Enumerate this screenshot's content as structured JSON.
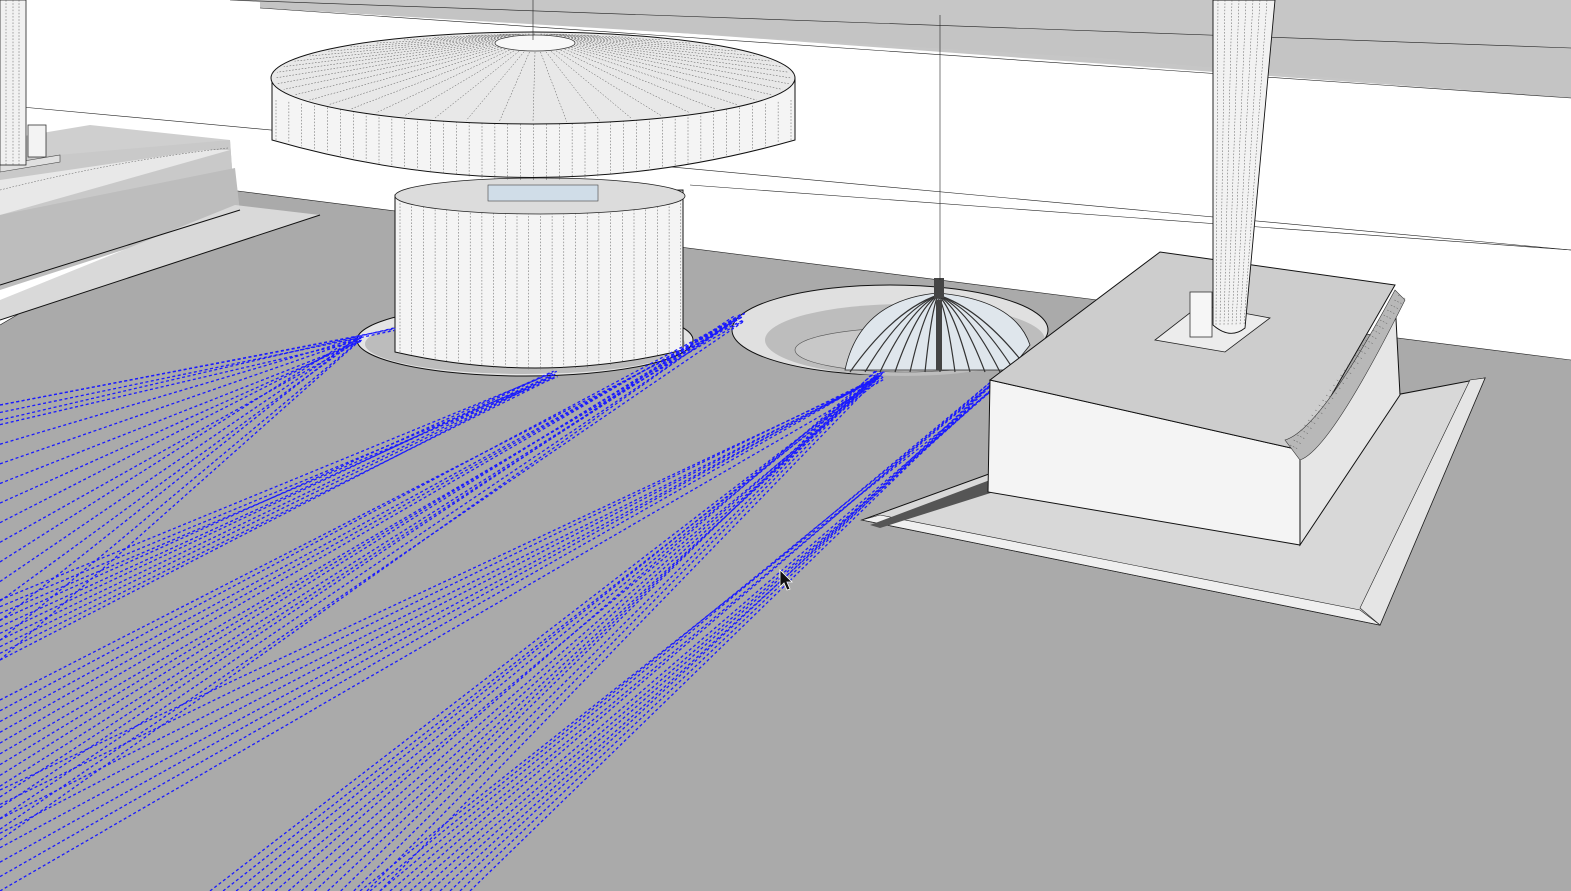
{
  "app": {
    "kind": "3D modeling viewport",
    "view": "perspective"
  },
  "scene": {
    "background_color": "#ffffff",
    "wall_band_color": "#c4c4c4",
    "ground_color": "#aaaaaa",
    "face_color": "#f2f2f2",
    "shadow_face_color": "#bdbdbd",
    "edge_color": "#111111",
    "selection_color": "#1a1aff",
    "objects": [
      "left-pedestal",
      "large-disc-top",
      "cylinder-column",
      "dome-fixture",
      "right-pedestal",
      "vertical-pole-right",
      "vertical-pole-left",
      "selected-edge-bundles"
    ]
  },
  "cursor": {
    "type": "arrow-pointer"
  }
}
